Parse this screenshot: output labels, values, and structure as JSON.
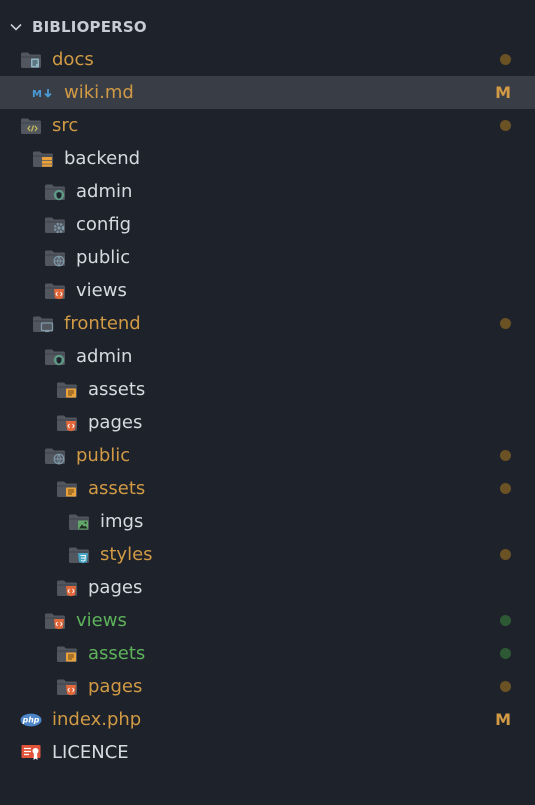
{
  "explorer": {
    "title": "BIBLIOPERSO",
    "colors": {
      "background": "#1e222a",
      "selected_row": "#393d45",
      "modified": "#d19a45",
      "modified_dot": "#6b5224",
      "added": "#5db35a",
      "added_dot": "#2d5a34",
      "default_text": "#d7dae0"
    },
    "items": [
      {
        "label": "docs",
        "depth": 0,
        "icon": "folder-docs-icon",
        "color": "modified",
        "status": "dot",
        "status_color": "modified_dot"
      },
      {
        "label": "wiki.md",
        "depth": 1,
        "icon": "markdown-icon",
        "color": "modified",
        "status": "M",
        "status_color": "modified",
        "selected": true
      },
      {
        "label": "src",
        "depth": 0,
        "icon": "folder-src-icon",
        "color": "modified",
        "status": "dot",
        "status_color": "modified_dot"
      },
      {
        "label": "backend",
        "depth": 1,
        "icon": "folder-server-icon",
        "color": "default",
        "status": ""
      },
      {
        "label": "admin",
        "depth": 2,
        "icon": "folder-admin-icon",
        "color": "default",
        "status": ""
      },
      {
        "label": "config",
        "depth": 2,
        "icon": "folder-config-icon",
        "color": "default",
        "status": ""
      },
      {
        "label": "public",
        "depth": 2,
        "icon": "folder-public-icon",
        "color": "default",
        "status": ""
      },
      {
        "label": "views",
        "depth": 2,
        "icon": "folder-views-icon",
        "color": "default",
        "status": ""
      },
      {
        "label": "frontend",
        "depth": 1,
        "icon": "folder-client-icon",
        "color": "modified",
        "status": "dot",
        "status_color": "modified_dot"
      },
      {
        "label": "admin",
        "depth": 2,
        "icon": "folder-admin-icon",
        "color": "default",
        "status": ""
      },
      {
        "label": "assets",
        "depth": 3,
        "icon": "folder-assets-icon",
        "color": "default",
        "status": ""
      },
      {
        "label": "pages",
        "depth": 3,
        "icon": "folder-views-icon",
        "color": "default",
        "status": ""
      },
      {
        "label": "public",
        "depth": 2,
        "icon": "folder-public-icon",
        "color": "modified",
        "status": "dot",
        "status_color": "modified_dot"
      },
      {
        "label": "assets",
        "depth": 3,
        "icon": "folder-assets-icon",
        "color": "modified",
        "status": "dot",
        "status_color": "modified_dot"
      },
      {
        "label": "imgs",
        "depth": 4,
        "icon": "folder-images-icon",
        "color": "default",
        "status": ""
      },
      {
        "label": "styles",
        "depth": 4,
        "icon": "folder-css-icon",
        "color": "modified",
        "status": "dot",
        "status_color": "modified_dot"
      },
      {
        "label": "pages",
        "depth": 3,
        "icon": "folder-views-icon",
        "color": "default",
        "status": ""
      },
      {
        "label": "views",
        "depth": 2,
        "icon": "folder-views-icon",
        "color": "added",
        "status": "dot",
        "status_color": "added_dot"
      },
      {
        "label": "assets",
        "depth": 3,
        "icon": "folder-assets-icon",
        "color": "added",
        "status": "dot",
        "status_color": "added_dot"
      },
      {
        "label": "pages",
        "depth": 3,
        "icon": "folder-views-icon",
        "color": "modified",
        "status": "dot",
        "status_color": "modified_dot"
      },
      {
        "label": "index.php",
        "depth": 0,
        "icon": "php-icon",
        "color": "modified",
        "status": "M",
        "status_color": "modified"
      },
      {
        "label": "LICENCE",
        "depth": 0,
        "icon": "license-icon",
        "color": "default",
        "status": ""
      }
    ]
  }
}
